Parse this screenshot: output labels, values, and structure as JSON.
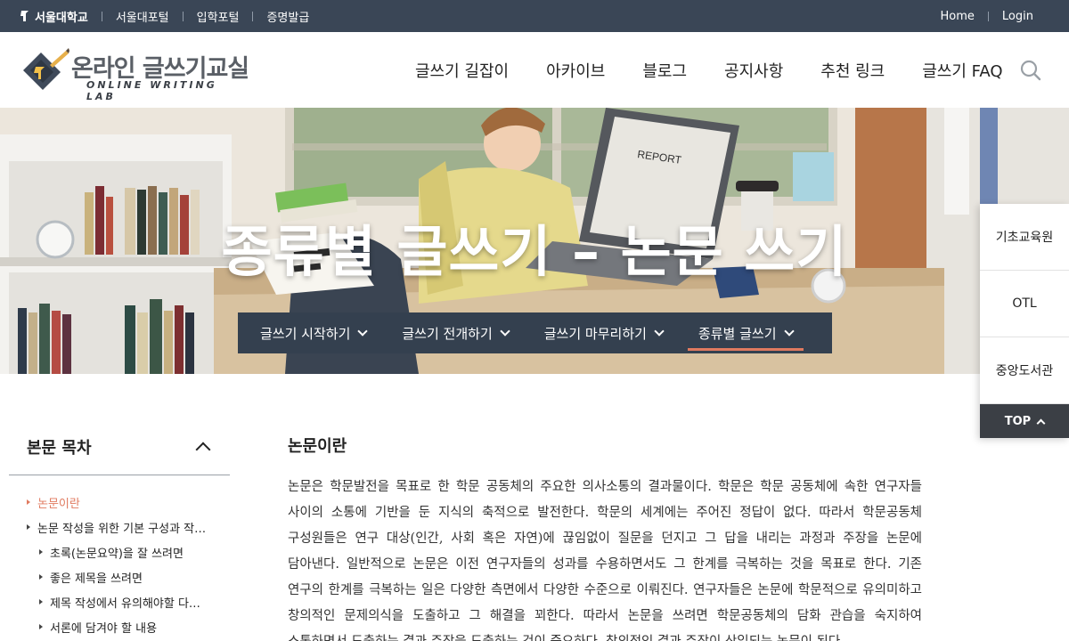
{
  "utility": {
    "logo": "서울대학교",
    "links": [
      "서울대포털",
      "입학포털",
      "증명발급"
    ],
    "home": "Home",
    "login": "Login"
  },
  "brand": {
    "kor": "온라인 글쓰기교실",
    "eng": "ONLINE WRITING LAB"
  },
  "gnb": [
    "글쓰기 길잡이",
    "아카이브",
    "블로그",
    "공지사항",
    "추천 링크",
    "글쓰기 FAQ"
  ],
  "hero": {
    "title": "종류별 글쓰기 – 논문 쓰기",
    "tabs": [
      "글쓰기 시작하기",
      "글쓰기 전개하기",
      "글쓰기 마무리하기",
      "종류별 글쓰기"
    ],
    "active_tab": 3,
    "illustration_text": "REPORT"
  },
  "quick": {
    "items": [
      "기초교육원",
      "OTL",
      "중앙도서관"
    ],
    "top": "TOP"
  },
  "toc": {
    "title": "본문 목차",
    "items": [
      {
        "label": "논문이란",
        "level": 1,
        "active": true
      },
      {
        "label": "논문 작성을 위한 기본 구성과 작…",
        "level": 1,
        "active": false
      },
      {
        "label": "초록(논문요약)을 잘 쓰려면",
        "level": 2,
        "active": false
      },
      {
        "label": "좋은 제목을 쓰려면",
        "level": 2,
        "active": false
      },
      {
        "label": "제목 작성에서 유의해야할 다…",
        "level": 2,
        "active": false
      },
      {
        "label": "서론에 담겨야 할 내용",
        "level": 2,
        "active": false
      }
    ]
  },
  "article": {
    "heading": "논문이란",
    "body": "논문은 학문발전을 목표로 한 학문 공동체의 주요한 의사소통의 결과물이다. 학문은 학문 공동체에 속한 연구자들 사이의 소통에 기반을 둔 지식의 축적으로 발전한다. 학문의 세계에는 주어진 정답이 없다. 따라서 학문공동체 구성원들은 연구 대상(인간, 사회 혹은 자연)에 끊임없이 질문을 던지고 그 답을 내리는 과정과 주장을 논문에 담아낸다. 일반적으로 논문은 이전 연구자들의 성과를 수용하면서도 그 한계를 극복하는 것을 목표로 한다. 기존 연구의 한계를 극복하는 일은 다양한 측면에서 다양한 수준으로 이뤄진다. 연구자들은 논문에 학문적으로 유의미하고 창의적인 문제의식을 도출하고 그 해결을 꾀한다. 따라서 논문을 쓰려면 학문공동체의 담화 관습을 숙지하여 소통하면서 도출하는 결과 주장을 도출하는 것이 중요하다. 창의적인 결과 주장이 산입되는 논문이 된다."
  }
}
